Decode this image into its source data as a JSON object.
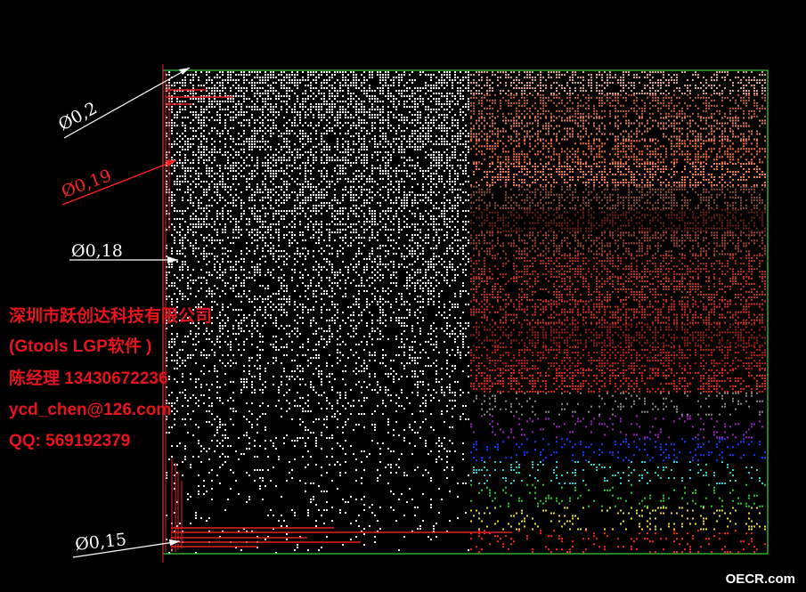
{
  "dimensions": {
    "d02": "Ø0,2",
    "d019": "Ø0,19",
    "d018": "Ø0,18",
    "d015": "Ø0,15"
  },
  "company": {
    "name": "深圳市跃创达科技有限公司",
    "product": "(Gtools LGP软件 )",
    "contact": "陈经理 13430672236",
    "email": "ycd_chen@126.com",
    "qq": "QQ: 569192379"
  },
  "watermark": "OECR.com",
  "colors": {
    "frame": "#3cd23c",
    "dimension_red": "#ff2020",
    "dimension_white": "#ffffff",
    "text_red": "#e8141c",
    "stripe_palette": [
      "#d8a090",
      "#c05a3c",
      "#e07a5a",
      "#e8642a",
      "#f07840",
      "#8c4a3a",
      "#6a1e14",
      "#a04030",
      "#b02a1e",
      "#c03020",
      "#d02a20",
      "#9a1a14",
      "#b81a14",
      "#e02018",
      "#8a8a8a",
      "#a020c0",
      "#1a3aff",
      "#20d0d0",
      "#2ac82a",
      "#e8e020",
      "#ff2020"
    ]
  }
}
